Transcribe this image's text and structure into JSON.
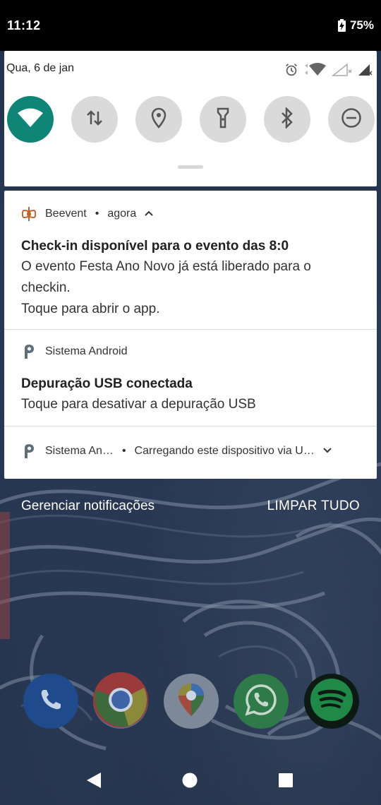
{
  "status_bar": {
    "time": "11:12",
    "battery": "75%"
  },
  "quick_settings": {
    "date": "Qua, 6 de jan",
    "tiles": [
      {
        "name": "wifi",
        "active": true
      },
      {
        "name": "mobile-data",
        "active": false
      },
      {
        "name": "location",
        "active": false
      },
      {
        "name": "flashlight",
        "active": false
      },
      {
        "name": "bluetooth",
        "active": false
      },
      {
        "name": "do-not-disturb",
        "active": false
      }
    ]
  },
  "notifications": [
    {
      "app": "Beevent",
      "time": "agora",
      "title": "Check-in disponível para o evento das 8:0",
      "lines": [
        "O evento Festa Ano Novo já está liberado para o checkin.",
        "Toque para abrir o app."
      ]
    },
    {
      "app": "Sistema Android",
      "title": "Depuração USB conectada",
      "lines": [
        "Toque para desativar a depuração USB"
      ]
    },
    {
      "app": "Sistema An…",
      "summary": "Carregando este dispositivo via U…"
    }
  ],
  "actions": {
    "manage": "Gerenciar notificações",
    "clear_all": "LIMPAR TUDO"
  },
  "dock": [
    "phone-icon",
    "chrome-icon",
    "maps-icon",
    "whatsapp-icon",
    "spotify-icon"
  ],
  "colors": {
    "accent": "#0f8577",
    "beevent": "#c0632a"
  }
}
